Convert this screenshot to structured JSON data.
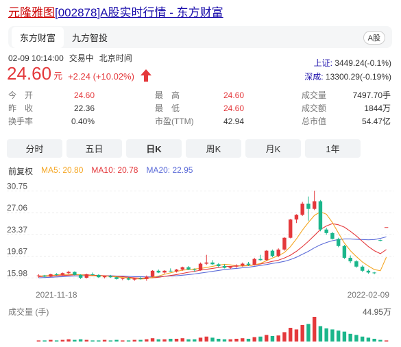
{
  "title": {
    "name": "元隆雅图",
    "rest": "[002878]A股实时行情 - 东方财富"
  },
  "source_tabs": [
    "东方财富",
    "九方智投"
  ],
  "market_badge": "A股",
  "meta": {
    "datetime": "02-09 10:14:00",
    "status": "交易中",
    "tz": "北京时间"
  },
  "price": {
    "value": "24.60",
    "unit": "元",
    "change": "+2.24 (+10.02%)"
  },
  "indices": [
    {
      "name": "上证:",
      "value": "3449.24(-0.1%)"
    },
    {
      "name": "深成:",
      "value": "13300.29(-0.19%)"
    }
  ],
  "stats": [
    [
      {
        "label": "今　开",
        "value": "24.60",
        "red": true
      },
      {
        "label": "昨　收",
        "value": "22.36",
        "red": false
      },
      {
        "label": "换手率",
        "value": "0.40%",
        "red": false
      }
    ],
    [
      {
        "label": "最　高",
        "value": "24.60",
        "red": true
      },
      {
        "label": "最　低",
        "value": "24.60",
        "red": true
      },
      {
        "label": "市盈(TTM)",
        "value": "42.94",
        "red": false
      }
    ],
    [
      {
        "label": "成交量",
        "value": "7497.70手",
        "red": false
      },
      {
        "label": "成交额",
        "value": "1844万",
        "red": false
      },
      {
        "label": "总市值",
        "value": "54.47亿",
        "red": false
      }
    ]
  ],
  "period_tabs": [
    "分时",
    "五日",
    "日K",
    "周K",
    "月K",
    "1年"
  ],
  "active_period": "日K",
  "legend": {
    "adj": "前复权",
    "ma": [
      {
        "text": "MA5: 20.80",
        "color": "#f5a623"
      },
      {
        "text": "MA10: 20.78",
        "color": "#e4393c"
      },
      {
        "text": "MA20: 22.95",
        "color": "#5b6bd8"
      }
    ]
  },
  "chart_data": {
    "type": "candlestick",
    "y_ticks": [
      "30.75",
      "27.06",
      "23.37",
      "19.67",
      "15.98"
    ],
    "ylim": [
      14.5,
      31.5
    ],
    "x_labels": [
      "2021-11-18",
      "2022-02-09"
    ],
    "up_color": "#e4393c",
    "down_color": "#1bb68b",
    "candles": [
      [
        16.3,
        16.6,
        16.0,
        16.4
      ],
      [
        16.4,
        16.5,
        16.1,
        16.2
      ],
      [
        16.2,
        16.7,
        16.1,
        16.6
      ],
      [
        16.6,
        16.8,
        16.4,
        16.5
      ],
      [
        16.5,
        16.9,
        16.4,
        16.8
      ],
      [
        16.8,
        17.2,
        16.6,
        17.0
      ],
      [
        17.0,
        17.1,
        16.4,
        16.5
      ],
      [
        16.5,
        16.6,
        15.8,
        16.0
      ],
      [
        16.0,
        16.7,
        15.9,
        16.6
      ],
      [
        16.6,
        16.9,
        16.4,
        16.5
      ],
      [
        16.5,
        16.6,
        16.0,
        16.1
      ],
      [
        16.1,
        16.4,
        15.9,
        16.3
      ],
      [
        16.3,
        16.5,
        16.0,
        16.1
      ],
      [
        16.1,
        16.2,
        15.7,
        15.8
      ],
      [
        15.8,
        16.0,
        15.6,
        15.9
      ],
      [
        15.9,
        16.1,
        15.6,
        15.7
      ],
      [
        15.7,
        16.0,
        15.5,
        15.9
      ],
      [
        15.9,
        16.2,
        15.7,
        15.8
      ],
      [
        15.8,
        16.4,
        15.5,
        16.2
      ],
      [
        16.2,
        17.3,
        16.1,
        17.2
      ],
      [
        17.2,
        17.4,
        16.8,
        16.9
      ],
      [
        16.9,
        17.3,
        16.7,
        17.2
      ],
      [
        17.2,
        17.6,
        17.0,
        17.1
      ],
      [
        17.1,
        17.5,
        16.9,
        17.4
      ],
      [
        17.4,
        17.9,
        17.2,
        17.8
      ],
      [
        17.8,
        18.0,
        17.3,
        17.4
      ],
      [
        17.4,
        17.6,
        17.0,
        17.3
      ],
      [
        17.3,
        18.6,
        17.2,
        18.4
      ],
      [
        18.4,
        19.9,
        18.2,
        18.6
      ],
      [
        18.6,
        19.0,
        18.2,
        18.3
      ],
      [
        18.3,
        18.5,
        17.8,
        18.0
      ],
      [
        18.0,
        18.3,
        17.6,
        17.7
      ],
      [
        17.7,
        18.0,
        17.5,
        17.9
      ],
      [
        17.9,
        18.3,
        17.7,
        18.1
      ],
      [
        18.1,
        18.6,
        17.9,
        18.4
      ],
      [
        18.4,
        18.7,
        18.0,
        18.2
      ],
      [
        18.2,
        19.4,
        18.1,
        19.2
      ],
      [
        19.2,
        19.9,
        18.9,
        19.0
      ],
      [
        19.0,
        20.7,
        18.9,
        20.6
      ],
      [
        20.6,
        20.8,
        19.5,
        19.7
      ],
      [
        19.7,
        21.0,
        19.5,
        20.8
      ],
      [
        20.8,
        22.9,
        20.6,
        22.8
      ],
      [
        22.8,
        26.0,
        22.7,
        25.9
      ],
      [
        25.9,
        26.8,
        25.3,
        26.7
      ],
      [
        26.7,
        28.9,
        26.5,
        28.6
      ],
      [
        28.6,
        29.8,
        25.7,
        27.7
      ],
      [
        27.7,
        30.8,
        27.5,
        29.0
      ],
      [
        29.0,
        29.2,
        23.9,
        24.2
      ],
      [
        24.2,
        24.5,
        23.3,
        23.6
      ],
      [
        23.6,
        23.8,
        22.5,
        22.6
      ],
      [
        22.6,
        22.8,
        21.2,
        21.4
      ],
      [
        21.4,
        21.6,
        19.2,
        19.4
      ],
      [
        19.4,
        19.8,
        18.5,
        18.8
      ],
      [
        18.8,
        19.0,
        17.7,
        17.9
      ],
      [
        17.9,
        18.1,
        17.0,
        17.2
      ],
      [
        17.2,
        17.4,
        16.7,
        16.9
      ],
      [
        16.9,
        17.0,
        16.6,
        16.8
      ],
      [
        22.4,
        22.5,
        22.2,
        22.36
      ],
      [
        24.6,
        24.6,
        24.6,
        24.6
      ]
    ],
    "ma5": [
      16.3,
      16.35,
      16.4,
      16.5,
      16.55,
      16.6,
      16.6,
      16.5,
      16.4,
      16.35,
      16.3,
      16.3,
      16.25,
      16.15,
      16.05,
      15.95,
      15.85,
      15.8,
      15.85,
      16.1,
      16.3,
      16.6,
      16.85,
      17.1,
      17.3,
      17.4,
      17.5,
      17.6,
      17.75,
      17.95,
      18.15,
      18.3,
      18.2,
      18.05,
      18.0,
      18.05,
      18.2,
      18.45,
      18.9,
      19.35,
      19.75,
      20.3,
      21.3,
      22.6,
      24.1,
      25.4,
      26.6,
      27.2,
      26.8,
      25.4,
      23.6,
      21.9,
      20.6,
      19.6,
      18.7,
      18.0,
      17.4,
      17.2,
      19.5
    ],
    "ma10": [
      16.2,
      16.25,
      16.3,
      16.35,
      16.4,
      16.45,
      16.5,
      16.5,
      16.5,
      16.45,
      16.4,
      16.35,
      16.3,
      16.25,
      16.2,
      16.1,
      16.0,
      15.95,
      15.95,
      16.0,
      16.1,
      16.25,
      16.4,
      16.55,
      16.75,
      16.95,
      17.1,
      17.3,
      17.45,
      17.6,
      17.75,
      17.9,
      17.95,
      18.0,
      18.05,
      18.1,
      18.2,
      18.35,
      18.55,
      18.8,
      19.0,
      19.35,
      19.85,
      20.5,
      21.3,
      22.2,
      23.2,
      24.2,
      24.8,
      25.2,
      25.0,
      24.6,
      23.9,
      23.1,
      22.2,
      21.3,
      20.6,
      20.1,
      20.8
    ],
    "ma20": [
      16.0,
      16.05,
      16.1,
      16.15,
      16.2,
      16.25,
      16.3,
      16.3,
      16.35,
      16.35,
      16.35,
      16.35,
      16.35,
      16.3,
      16.3,
      16.25,
      16.2,
      16.2,
      16.15,
      16.15,
      16.2,
      16.25,
      16.3,
      16.35,
      16.45,
      16.55,
      16.65,
      16.8,
      16.95,
      17.1,
      17.25,
      17.4,
      17.5,
      17.6,
      17.7,
      17.8,
      17.95,
      18.1,
      18.25,
      18.45,
      18.6,
      18.8,
      19.1,
      19.5,
      20.0,
      20.5,
      21.1,
      21.6,
      22.0,
      22.3,
      22.5,
      22.6,
      22.6,
      22.55,
      22.5,
      22.45,
      22.5,
      22.7,
      22.95
    ],
    "volume_max_label": "44.95万",
    "volumes": [
      2,
      2,
      3,
      2,
      3,
      4,
      3,
      4,
      3,
      2,
      2,
      3,
      2,
      3,
      2,
      2,
      3,
      3,
      4,
      6,
      4,
      4,
      5,
      5,
      6,
      4,
      4,
      7,
      9,
      7,
      5,
      4,
      4,
      5,
      6,
      5,
      8,
      9,
      12,
      10,
      11,
      17,
      25,
      22,
      30,
      32,
      45,
      28,
      24,
      22,
      20,
      18,
      14,
      12,
      9,
      7,
      5,
      3,
      2
    ]
  },
  "volume_label": "成交量 (手)"
}
